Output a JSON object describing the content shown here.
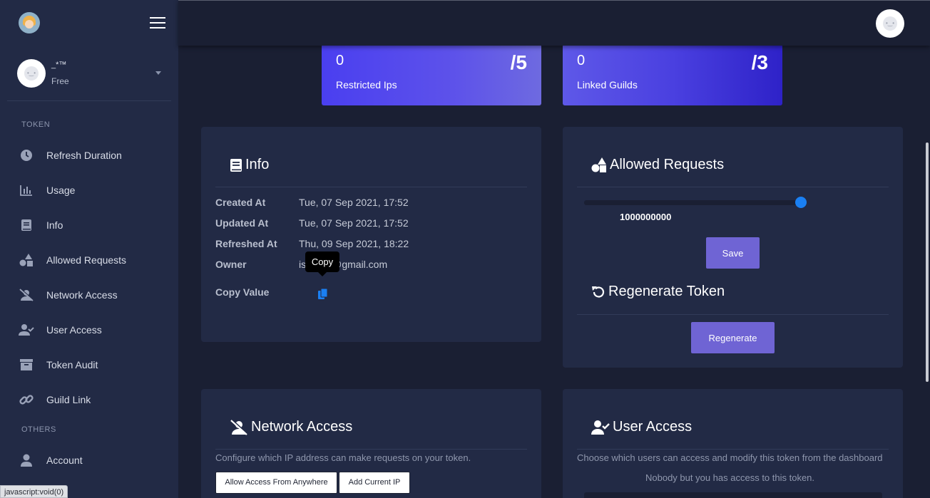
{
  "sidebar": {
    "user": {
      "name": "_*™",
      "plan": "Free"
    },
    "sections": [
      {
        "label": "TOKEN",
        "items": [
          {
            "label": "Refresh Duration",
            "icon": "clock-icon"
          },
          {
            "label": "Usage",
            "icon": "bar-chart-icon"
          },
          {
            "label": "Info",
            "icon": "book-icon"
          },
          {
            "label": "Allowed Requests",
            "icon": "shapes-icon"
          },
          {
            "label": "Network Access",
            "icon": "user-slash-icon"
          },
          {
            "label": "User Access",
            "icon": "user-check-icon"
          },
          {
            "label": "Token Audit",
            "icon": "archive-icon"
          },
          {
            "label": "Guild Link",
            "icon": "link-icon"
          }
        ]
      },
      {
        "label": "OTHERS",
        "items": [
          {
            "label": "Account",
            "icon": "user-icon"
          }
        ]
      }
    ]
  },
  "stats": {
    "restricted_ips": {
      "value": "0",
      "max": "/5",
      "label": "Restricted Ips"
    },
    "linked_guilds": {
      "value": "0",
      "max": "/3",
      "label": "Linked Guilds"
    }
  },
  "info": {
    "title": "Info",
    "rows": [
      {
        "key": "Created At",
        "value": "Tue, 07 Sep 2021, 17:52"
      },
      {
        "key": "Updated At",
        "value": "Tue, 07 Sep 2021, 17:52"
      },
      {
        "key": "Refreshed At",
        "value": "Thu, 09 Sep 2021, 18:22"
      },
      {
        "key": "Owner",
        "value_start": "is",
        "value_end": "@gmail.com"
      }
    ],
    "copy_label": "Copy Value",
    "tooltip": "Copy"
  },
  "allowed_requests": {
    "title": "Allowed Requests",
    "slider_value": "1000000000",
    "slider_fraction": 1.0,
    "save_label": "Save"
  },
  "regenerate": {
    "title": "Regenerate Token",
    "button_label": "Regenerate"
  },
  "network_access": {
    "title": "Network Access",
    "description": "Configure which IP address can make requests on your token.",
    "allow_anywhere_label": "Allow Access From Anywhere",
    "add_current_ip_label": "Add Current IP"
  },
  "user_access": {
    "title": "User Access",
    "description": "Choose which users can access and modify this token from the dashboard",
    "empty_text": "Nobody but you has access to this token."
  },
  "status_bar": "javascript:void(0)",
  "colors": {
    "background": "#1a1f33",
    "card": "#222a45",
    "accent": "#6f64d4",
    "slider_thumb": "#1a7ff2"
  }
}
